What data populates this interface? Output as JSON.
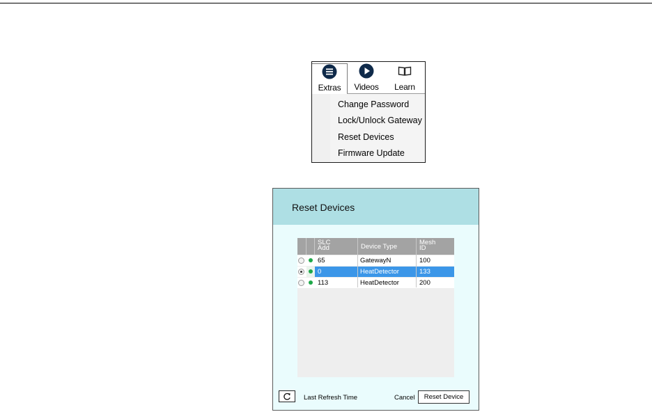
{
  "menu": {
    "toolbar": [
      {
        "label": "Extras",
        "icon": "menu-icon"
      },
      {
        "label": "Videos",
        "icon": "play-icon"
      },
      {
        "label": "Learn",
        "icon": "book-icon"
      }
    ],
    "items": [
      "Change Password",
      "Lock/Unlock Gateway",
      "Reset Devices",
      "Firmware Update"
    ]
  },
  "dialog": {
    "title": "Reset Devices",
    "columns": {
      "slc_add_line1": "SLC",
      "slc_add_line2": "Add",
      "device_type": "Device Type",
      "mesh_id_line1": "Mesh",
      "mesh_id_line2": "ID"
    },
    "rows": [
      {
        "slc_add": "65",
        "device_type": "GatewayN",
        "mesh_id": "100",
        "selected": false,
        "status": "online"
      },
      {
        "slc_add": "0",
        "device_type": "HeatDetector",
        "mesh_id": "133",
        "selected": true,
        "status": "online"
      },
      {
        "slc_add": "113",
        "device_type": "HeatDetector",
        "mesh_id": "200",
        "selected": false,
        "status": "online"
      }
    ],
    "refresh_icon": "refresh-icon",
    "last_refresh_label": "Last Refresh Time",
    "cancel_label": "Cancel",
    "reset_button_label": "Reset Device"
  },
  "colors": {
    "header_bg": "#aedfe4",
    "dialog_bg": "#eafcfd",
    "grid_header": "#a3a3a3",
    "selection": "#3b96e8",
    "status_online": "#1fa84a",
    "icon_dark": "#0f2a4a"
  }
}
